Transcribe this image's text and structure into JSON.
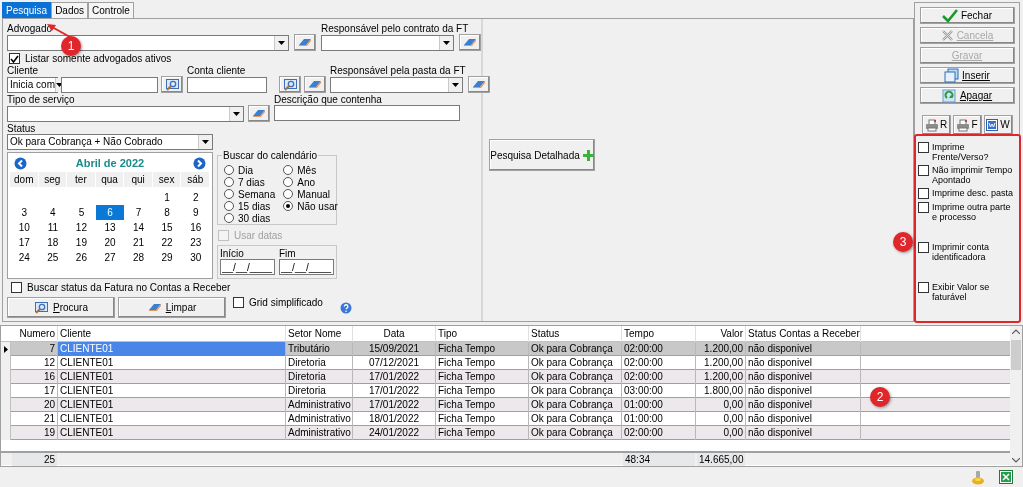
{
  "tabs": [
    {
      "label": "Pesquisa",
      "selected": true
    },
    {
      "label": "Dados",
      "selected": false
    },
    {
      "label": "Controle",
      "selected": false
    }
  ],
  "form": {
    "advogado": {
      "label": "Advogado"
    },
    "responsavel_contrato": {
      "label": "Responsável pelo contrato da FT"
    },
    "listar_ativos": {
      "label": "Listar somente advogados ativos",
      "checked": true
    },
    "cliente": {
      "label": "Cliente",
      "mode": "Inicia com"
    },
    "conta_cliente": {
      "label": "Conta cliente"
    },
    "responsavel_pasta": {
      "label": "Responsável pela pasta da FT"
    },
    "tipo_servico": {
      "label": "Tipo de serviço"
    },
    "descricao": {
      "label": "Descrição que contenha"
    },
    "status": {
      "label": "Status",
      "value": "Ok para Cobrança + Não Cobrado"
    }
  },
  "calendar": {
    "title": "Abril de 2022",
    "weekdays": [
      "dom",
      "seg",
      "ter",
      "qua",
      "qui",
      "sex",
      "sáb"
    ],
    "weeks": [
      [
        {
          "day": "1",
          "selected": false
        },
        {
          "day": "2",
          "selected": false
        }
      ],
      [
        {
          "day": "3",
          "selected": false
        },
        {
          "day": "4",
          "selected": false
        },
        {
          "day": "5",
          "selected": false
        },
        {
          "day": "6",
          "selected": true
        },
        {
          "day": "7",
          "selected": false
        },
        {
          "day": "8",
          "selected": false
        },
        {
          "day": "9",
          "selected": false
        }
      ],
      [
        {
          "day": "10",
          "selected": false
        },
        {
          "day": "11",
          "selected": false
        },
        {
          "day": "12",
          "selected": false
        },
        {
          "day": "13",
          "selected": false
        },
        {
          "day": "14",
          "selected": false
        },
        {
          "day": "15",
          "selected": false
        },
        {
          "day": "16",
          "selected": false
        }
      ],
      [
        {
          "day": "17",
          "selected": false
        },
        {
          "day": "18",
          "selected": false
        },
        {
          "day": "19",
          "selected": false
        },
        {
          "day": "20",
          "selected": false
        },
        {
          "day": "21",
          "selected": false
        },
        {
          "day": "22",
          "selected": false
        },
        {
          "day": "23",
          "selected": false
        }
      ],
      [
        {
          "day": "24",
          "selected": false
        },
        {
          "day": "25",
          "selected": false
        },
        {
          "day": "26",
          "selected": false
        },
        {
          "day": "27",
          "selected": false
        },
        {
          "day": "28",
          "selected": false
        },
        {
          "day": "29",
          "selected": false
        },
        {
          "day": "30",
          "selected": false
        }
      ]
    ]
  },
  "buscar_calendario": {
    "title": "Buscar do calendário",
    "options": [
      {
        "label": "Dia",
        "selected": false
      },
      {
        "label": "7 dias",
        "selected": false
      },
      {
        "label": "Semana",
        "selected": false
      },
      {
        "label": "15 dias",
        "selected": false
      },
      {
        "label": "30 dias",
        "selected": false
      },
      {
        "label": "Mês",
        "selected": false
      },
      {
        "label": "Ano",
        "selected": false
      },
      {
        "label": "Manual",
        "selected": false
      },
      {
        "label": "Não usar",
        "selected": true
      }
    ]
  },
  "usar_datas": {
    "label": "Usar datas",
    "checked": false,
    "disabled": true
  },
  "periodo": {
    "inicio": {
      "label": "Início",
      "value": "__/__/____"
    },
    "fim": {
      "label": "Fim",
      "value": "__/__/____"
    }
  },
  "buscar_status_fatura": {
    "label": "Buscar status da Fatura no Contas a Receber",
    "checked": false
  },
  "actions": [
    {
      "label": "Procura"
    },
    {
      "label": "Limpar"
    }
  ],
  "grid_simplificado": {
    "label": "Grid simplificado",
    "checked": false
  },
  "pesquisa_detalhada": {
    "label": "Pesquisa Detalhada"
  },
  "side_buttons": [
    {
      "label": "Fechar",
      "disabled": false,
      "accelerator": false
    },
    {
      "label": "Cancela",
      "disabled": true,
      "accelerator": true
    },
    {
      "label": "Gravar",
      "disabled": true,
      "accelerator": true
    },
    {
      "label": "Inserir",
      "disabled": false,
      "accelerator": true
    },
    {
      "label": "Apagar",
      "disabled": false,
      "accelerator": true
    }
  ],
  "print_buttons": [
    {
      "label": "R"
    },
    {
      "label": "F"
    },
    {
      "label": "W"
    }
  ],
  "print_options": [
    {
      "label": "Imprime Frente/Verso?",
      "checked": false,
      "kind": "short"
    },
    {
      "label": "Não imprimir Tempo Apontado",
      "checked": false,
      "kind": "short"
    },
    {
      "label": "Imprime desc. pasta",
      "checked": false,
      "kind": "short"
    },
    {
      "label": "Imprime outra parte e processo",
      "checked": false,
      "kind": "tall"
    },
    {
      "label": "Imprimir conta identificadora",
      "checked": false,
      "kind": "tall"
    },
    {
      "label": "Exibir Valor se faturável",
      "checked": false,
      "kind": "tall"
    }
  ],
  "table": {
    "columns": [
      "Numero",
      "Cliente",
      "Setor Nome",
      "Data",
      "Tipo",
      "Status",
      "Tempo",
      "Valor",
      "Status Contas a Receber"
    ],
    "rows": [
      {
        "selected": true,
        "cells": [
          "7",
          "CLIENTE01",
          "Tributário",
          "15/09/2021",
          "Ficha Tempo",
          "Ok para Cobrança",
          "02:00:00",
          "1.200,00",
          "não disponivel"
        ]
      },
      {
        "selected": false,
        "cells": [
          "12",
          "CLIENTE01",
          "Diretoria",
          "07/12/2021",
          "Ficha Tempo",
          "Ok para Cobrança",
          "02:00:00",
          "1.200,00",
          "não disponivel"
        ]
      },
      {
        "selected": false,
        "cells": [
          "16",
          "CLIENTE01",
          "Diretoria",
          "17/01/2022",
          "Ficha Tempo",
          "Ok para Cobrança",
          "02:00:00",
          "1.200,00",
          "não disponivel"
        ]
      },
      {
        "selected": false,
        "cells": [
          "17",
          "CLIENTE01",
          "Diretoria",
          "17/01/2022",
          "Ficha Tempo",
          "Ok para Cobrança",
          "03:00:00",
          "1.800,00",
          "não disponivel"
        ]
      },
      {
        "selected": false,
        "cells": [
          "20",
          "CLIENTE01",
          "Administrativo",
          "17/01/2022",
          "Ficha Tempo",
          "Ok para Cobrança",
          "01:00:00",
          "0,00",
          "não disponivel"
        ]
      },
      {
        "selected": false,
        "cells": [
          "21",
          "CLIENTE01",
          "Administrativo",
          "18/01/2022",
          "Ficha Tempo",
          "Ok para Cobrança",
          "01:00:00",
          "0,00",
          "não disponivel"
        ]
      },
      {
        "selected": false,
        "cells": [
          "19",
          "CLIENTE01",
          "Administrativo",
          "24/01/2022",
          "Ficha Tempo",
          "Ok para Cobrança",
          "02:00:00",
          "0,00",
          "não disponivel"
        ]
      }
    ],
    "totals": {
      "count": "25",
      "tempo": "48:34",
      "valor": "14.665,00"
    }
  },
  "annotations": [
    {
      "label": "1",
      "kind": "arrow"
    },
    {
      "label": "2",
      "kind": "plain"
    },
    {
      "label": "3",
      "kind": "frame"
    }
  ]
}
